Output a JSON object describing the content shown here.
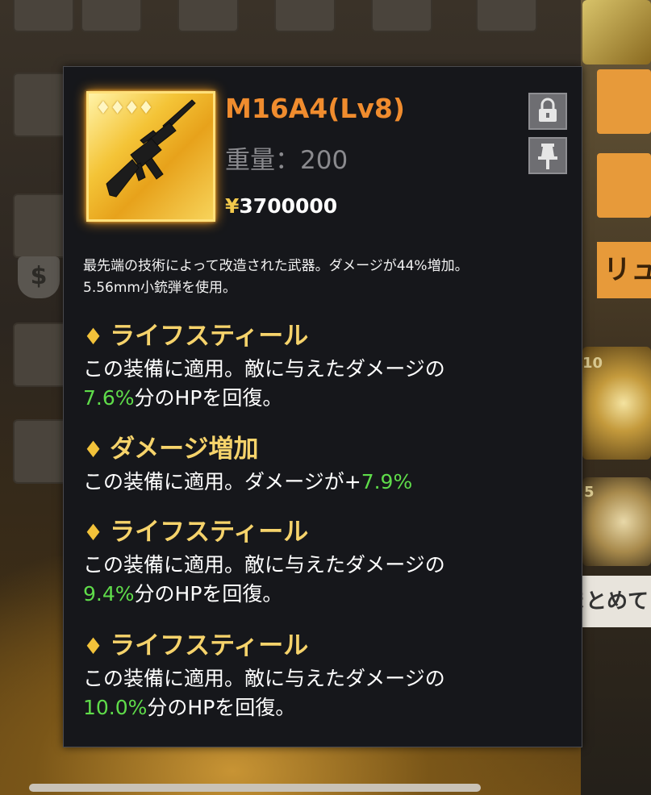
{
  "item": {
    "name": "M16A4(Lv8)",
    "weight_label": "重量：200",
    "currency_symbol": "¥",
    "price": "3700000",
    "rarity_diamonds": "♦♦♦♦",
    "description_line1": "最先端の技術によって改造された武器。ダメージが44%増加。",
    "description_line2": "5.56mm小銃弾を使用。"
  },
  "effects": [
    {
      "title": "ライフスティール",
      "text_before": "この装備に適用。敵に与えたダメージの",
      "value": "7.6%",
      "text_after": "分のHPを回復。"
    },
    {
      "title": "ダメージ増加",
      "text_before": "この装備に適用。ダメージが+",
      "value": "7.9%",
      "text_after": ""
    },
    {
      "title": "ライフスティール",
      "text_before": "この装備に適用。敵に与えたダメージの",
      "value": "9.4%",
      "text_after": "分のHPを回復。"
    },
    {
      "title": "ライフスティール",
      "text_before": "この装備に適用。敵に与えたダメージの",
      "value": "10.0%",
      "text_after": "分のHPを回復。"
    }
  ],
  "icons": {
    "gem": "♦",
    "lock": "lock-icon",
    "pin": "pin-icon",
    "shield": "$"
  },
  "background": {
    "side_button_1": "リュ",
    "side_button_2": "まとめて",
    "badge_1": "10",
    "badge_2": "5"
  },
  "colors": {
    "item_name": "#f08c2e",
    "effect_title": "#f6d36b",
    "highlight_value": "#5fdc4a",
    "panel_bg": "#16171b"
  }
}
